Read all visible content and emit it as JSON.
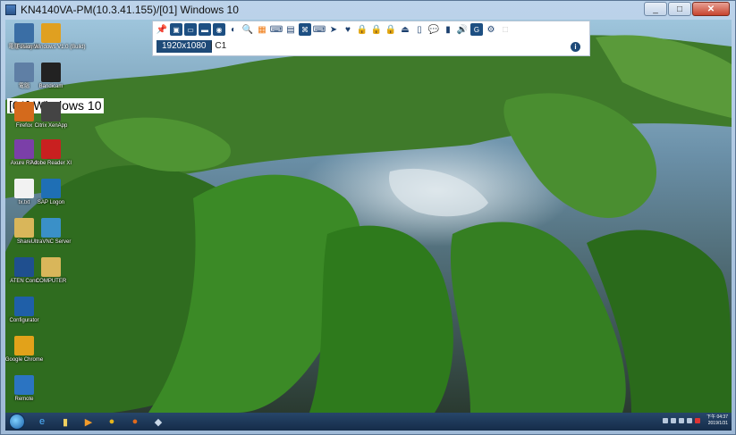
{
  "window": {
    "title": "KN4140VA-PM(10.3.41.155)/[01] Windows 10",
    "minimize": "_",
    "maximize": "□",
    "close": "✕"
  },
  "toolbar": {
    "resolution": "1920x1080",
    "channel": "| C1",
    "info": "i"
  },
  "session_label": "[01] Windows 10",
  "desktop_icons": [
    {
      "label": "電腦 Recycle",
      "color": "#3a6ea5"
    },
    {
      "label": "Fusion Windows V1.0 (Build)",
      "color": "#e0a020"
    },
    {
      "label": "電腦",
      "color": "#5f7fa5"
    },
    {
      "label": "Bandicam",
      "color": "#222222"
    },
    {
      "label": "Firefox",
      "color": "#d46a1c"
    },
    {
      "label": "Citrix XenApp",
      "color": "#444444"
    },
    {
      "label": "Axure RP 8",
      "color": "#7b3fa8"
    },
    {
      "label": "Adobe Reader XI",
      "color": "#c92020"
    },
    {
      "label": "tx.txt",
      "color": "#f2f2f2"
    },
    {
      "label": "SAP Logon",
      "color": "#1f6fb5"
    },
    {
      "label": "Share",
      "color": "#d9b65a"
    },
    {
      "label": "UltraVNC Server",
      "color": "#3a90c8"
    },
    {
      "label": "ATEN Conn",
      "color": "#1f4f8f"
    },
    {
      "label": "COMPUTER",
      "color": "#d9b65a"
    },
    {
      "label": "Configurator",
      "color": "#1f5fa8"
    },
    {
      "label": "Google Chrome",
      "color": "#e2a21a"
    },
    {
      "label": "Remote",
      "color": "#2b74c2"
    }
  ],
  "taskbar": {
    "time": "下午 04:37",
    "date": "2019/1/31"
  },
  "colors": {
    "toolbar_accent": "#1e4a78",
    "lock_orange": "#f07a12"
  }
}
